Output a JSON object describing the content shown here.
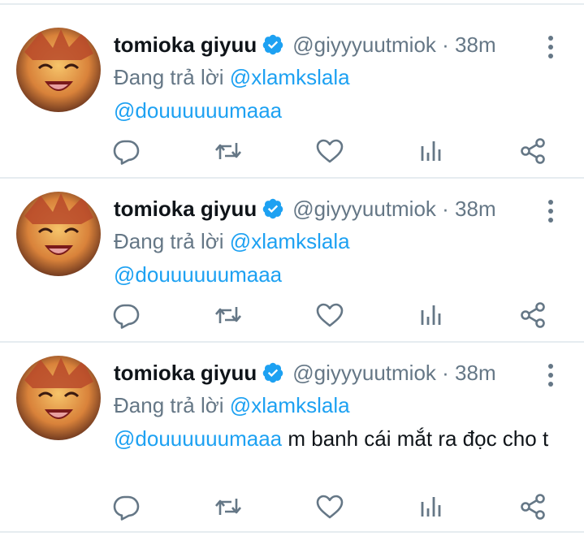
{
  "tweets": [
    {
      "name": "tomioka giyuu",
      "handle": "@giyyyuutmiok",
      "time": "· 38m",
      "reply_prefix": "Đang trả lời",
      "reply_to": "@xlamkslala",
      "mention": "@douuuuuumaaa",
      "text": ""
    },
    {
      "name": "tomioka giyuu",
      "handle": "@giyyyuutmiok",
      "time": "· 38m",
      "reply_prefix": "Đang trả lời",
      "reply_to": "@xlamkslala",
      "mention": "@douuuuuumaaa",
      "text": ""
    },
    {
      "name": "tomioka giyuu",
      "handle": "@giyyyuutmiok",
      "time": "· 38m",
      "reply_prefix": "Đang trả lời",
      "reply_to": "@xlamkslala",
      "mention": "@douuuuuumaaa",
      "text": " m banh cái mắt ra đọc cho t"
    }
  ],
  "icons": {
    "verified": "verified-badge-icon",
    "more": "more-vertical-icon",
    "reply": "reply-icon",
    "retweet": "retweet-icon",
    "like": "heart-icon",
    "analytics": "analytics-icon",
    "share": "share-icon"
  },
  "colors": {
    "accent": "#1da1f2",
    "text": "#0f1419",
    "muted": "#657786",
    "separator": "#e6ecf0"
  }
}
